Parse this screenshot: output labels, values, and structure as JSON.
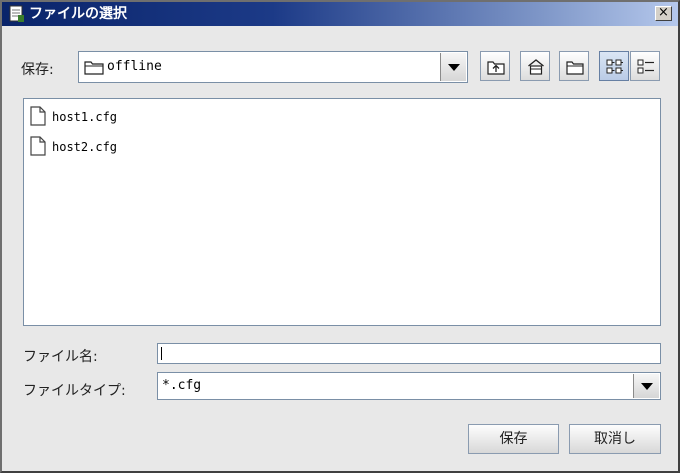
{
  "window": {
    "title": "ファイルの選択",
    "close_glyph": "×"
  },
  "save_in": {
    "label": "保存:",
    "value": "offline"
  },
  "toolbar": {
    "buttons": [
      {
        "name": "up-one-level-button",
        "icon": "folder-up-icon"
      },
      {
        "name": "home-button",
        "icon": "home-icon"
      },
      {
        "name": "new-folder-button",
        "icon": "new-folder-icon"
      },
      {
        "name": "list-view-button",
        "icon": "list-view-icon",
        "active": true
      },
      {
        "name": "details-view-button",
        "icon": "details-view-icon"
      }
    ]
  },
  "files": [
    {
      "name": "host1.cfg",
      "icon": "file-icon"
    },
    {
      "name": "host2.cfg",
      "icon": "file-icon"
    }
  ],
  "filename": {
    "label": "ファイル名:",
    "value": ""
  },
  "filetype": {
    "label": "ファイルタイプ:",
    "value": "*.cfg"
  },
  "buttons": {
    "save": "保存",
    "cancel": "取消し"
  }
}
